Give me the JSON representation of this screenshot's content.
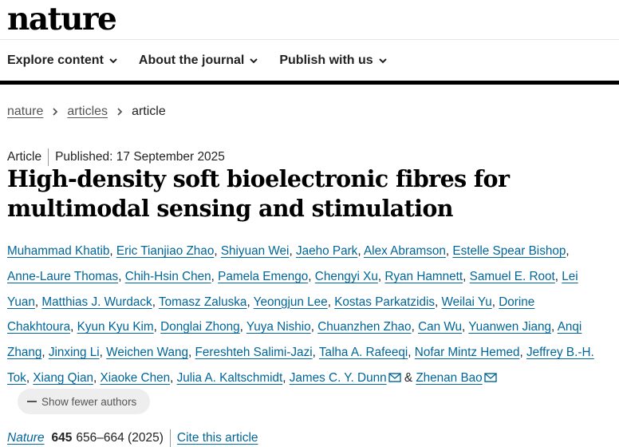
{
  "header": {
    "logo": "nature"
  },
  "nav": {
    "items": [
      {
        "label": "Explore content"
      },
      {
        "label": "About the journal"
      },
      {
        "label": "Publish with us"
      }
    ]
  },
  "breadcrumb": {
    "home": "nature",
    "section": "articles",
    "current": "article"
  },
  "article": {
    "type": "Article",
    "published": "Published: 17 September 2025",
    "title": "High-density soft bioelectronic fibres for multimodal sensing and stimulation"
  },
  "authors": {
    "list": [
      "Muhammad Khatib",
      "Eric Tianjiao Zhao",
      "Shiyuan Wei",
      "Jaeho Park",
      "Alex Abramson",
      "Estelle Spear Bishop",
      "Anne-Laure Thomas",
      "Chih-Hsin Chen",
      "Pamela Emengo",
      "Chengyi Xu",
      "Ryan Hamnett",
      "Samuel E. Root",
      "Lei Yuan",
      "Matthias J. Wurdack",
      "Tomasz Zaluska",
      "Yeongjun Lee",
      "Kostas Parkatzidis",
      "Weilai Yu",
      "Dorine Chakhtoura",
      "Kyun Kyu Kim",
      "Donglai Zhong",
      "Yuya Nishio",
      "Chuanzhen Zhao",
      "Can Wu",
      "Yuanwen Jiang",
      "Anqi Zhang",
      "Jinxing Li",
      "Weichen Wang",
      "Fereshteh Salimi-Jazi",
      "Talha A. Rafeeqi",
      "Nofar Mintz Hemed",
      "Jeffrey B.-H. Tok",
      "Xiang Qian",
      "Xiaoke Chen",
      "Julia A. Kaltschmidt",
      "James C. Y. Dunn",
      "Zhenan Bao"
    ],
    "separator": ",",
    "ampersand": "&",
    "show_fewer": "Show fewer authors"
  },
  "citation": {
    "journal": "Nature",
    "volume": "645",
    "pages": "656–664 (2025)",
    "cite_link": "Cite this article"
  },
  "colors": {
    "link": "#006699",
    "text": "#222222"
  }
}
